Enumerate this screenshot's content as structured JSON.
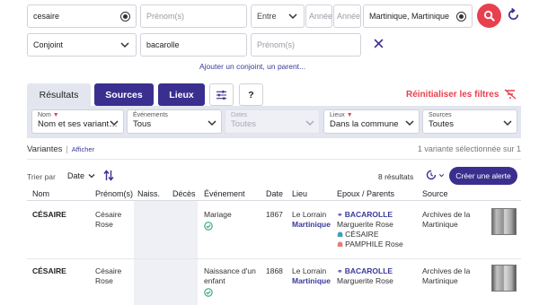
{
  "search": {
    "nom_value": "cesaire",
    "prenom_placeholder": "Prénom(s)",
    "entre_label": "Entre",
    "annee1_placeholder": "Année",
    "annee2_placeholder": "Année",
    "place_value": "Martinique, Martinique",
    "relation_select": "Conjoint",
    "relation_nom_value": "bacarolle",
    "relation_prenom_placeholder": "Prénom(s)",
    "add_link": "Ajouter un conjoint, un parent..."
  },
  "tabs": {
    "resultats": "Résultats",
    "sources": "Sources",
    "lieux": "Lieux",
    "help": "?",
    "reset": "Réinitialiser les filtres"
  },
  "filters": [
    {
      "label": "Nom",
      "value": "Nom et ses variant…"
    },
    {
      "label": "Événements",
      "value": "Tous"
    },
    {
      "label": "Dates",
      "value": "Toutes"
    },
    {
      "label": "Lieux",
      "value": "Dans la commune"
    },
    {
      "label": "Sources",
      "value": "Toutes"
    }
  ],
  "variants": {
    "label": "Variantes",
    "show": "Afficher",
    "selected": "1 variante sélectionnée sur 1"
  },
  "sort": {
    "label": "Trier par",
    "value": "Date",
    "count": "8 résultats",
    "alert_button": "Créer une alerte"
  },
  "columns": [
    "Nom",
    "Prénom(s)",
    "Naiss.",
    "Décès",
    "Événement",
    "Date",
    "Lieu",
    "Epoux / Parents",
    "Source"
  ],
  "rows": [
    {
      "nom": "CÉSAIRE",
      "prenom1": "Césaire",
      "prenom2": "Rose",
      "event1": "Mariage",
      "event2": "",
      "date": "1867",
      "lieu1": "Le Lorrain",
      "lieu2": "Martinique",
      "spouse": "BACAROLLE",
      "spouse_first": "Marguerite Rose",
      "parent1": "CÉSAIRE",
      "parent2": "PAMPHILE Rose",
      "source1": "Archives de la",
      "source2": "Martinique"
    },
    {
      "nom": "CÉSAIRE",
      "prenom1": "Césaire",
      "prenom2": "Rose",
      "event1": "Naissance d'un",
      "event2": "enfant",
      "date": "1868",
      "lieu1": "Le Lorrain",
      "lieu2": "Martinique",
      "spouse": "BACAROLLE",
      "spouse_first": "Marguerite Rose",
      "source1": "Archives de la",
      "source2": "Martinique"
    }
  ],
  "colors": {
    "primary": "#3a2f8f",
    "accent_red": "#e8404e",
    "link": "#3a3a9c",
    "tab_light": "#e3e6ef"
  }
}
